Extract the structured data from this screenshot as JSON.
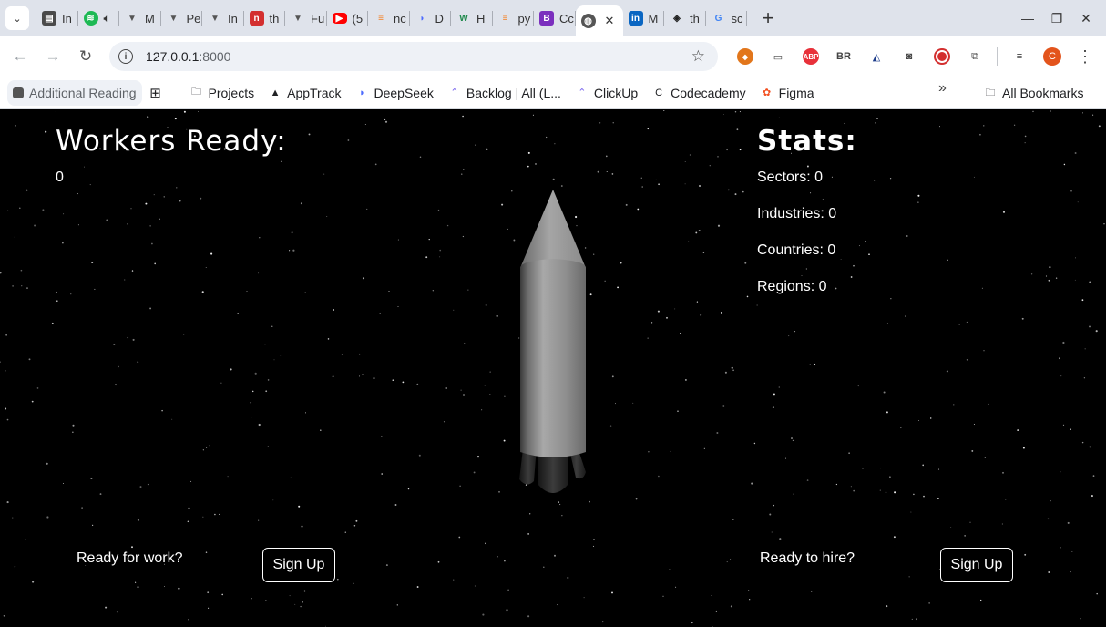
{
  "browser": {
    "tabs": [
      {
        "label": "In",
        "icon": "sheet-icon",
        "color": "#4a4a4a"
      },
      {
        "label": "",
        "icon": "spotify-icon",
        "color": "#1db954"
      },
      {
        "label": "M",
        "icon": "triangle-logo-icon",
        "color": "#555555"
      },
      {
        "label": "Pe",
        "icon": "triangle-logo-icon",
        "color": "#555555"
      },
      {
        "label": "In",
        "icon": "triangle-logo-icon",
        "color": "#555555"
      },
      {
        "label": "th",
        "icon": "n-logo-icon",
        "color": "#d32f2f"
      },
      {
        "label": "Fu",
        "icon": "triangle-logo-icon",
        "color": "#555555"
      },
      {
        "label": "(5",
        "icon": "youtube-icon",
        "color": "#ff0000"
      },
      {
        "label": "nc",
        "icon": "stack-icon",
        "color": "#f48024"
      },
      {
        "label": "D",
        "icon": "deepseek-icon",
        "color": "#4d6bfe"
      },
      {
        "label": "H",
        "icon": "w-logo-icon",
        "color": "#1f8a4c"
      },
      {
        "label": "py",
        "icon": "stack-icon",
        "color": "#f48024"
      },
      {
        "label": "Cc",
        "icon": "b-logo-icon",
        "color": "#7b2fbe"
      },
      {
        "label": "",
        "icon": "globe-icon",
        "color": "#555555",
        "active": true
      },
      {
        "label": "M",
        "icon": "linkedin-icon",
        "color": "#0a66c2"
      },
      {
        "label": "th",
        "icon": "codepen-icon",
        "color": "#222222"
      },
      {
        "label": "sc",
        "icon": "google-icon",
        "color": "#4285f4"
      }
    ],
    "url_host": "127.0.0.1",
    "url_port": ":8000",
    "bookmarks": [
      {
        "label": "Additional Reading",
        "icon": "square-icon"
      },
      {
        "label": "",
        "icon": "apps-grid-icon"
      },
      {
        "label": "Projects",
        "icon": "folder-icon"
      },
      {
        "label": "AppTrack",
        "icon": "apptrack-icon"
      },
      {
        "label": "DeepSeek",
        "icon": "deepseek-icon"
      },
      {
        "label": "Backlog | All (L...",
        "icon": "clickup-icon"
      },
      {
        "label": "ClickUp",
        "icon": "clickup-icon"
      },
      {
        "label": "Codecademy",
        "icon": "codecademy-icon"
      },
      {
        "label": "Figma",
        "icon": "figma-icon"
      }
    ],
    "more_bookmarks": "»",
    "all_bookmarks": "All Bookmarks",
    "profile_initial": "C"
  },
  "page": {
    "workers_title": "Workers Ready:",
    "workers_count": "0",
    "stats_title": "Stats:",
    "stats": [
      {
        "label": "Sectors: 0"
      },
      {
        "label": "Industries: 0"
      },
      {
        "label": "Countries: 0"
      },
      {
        "label": "Regions: 0"
      }
    ],
    "work_label": "Ready for work?",
    "work_button": "Sign Up",
    "hire_label": "Ready to hire?",
    "hire_button": "Sign Up"
  },
  "colors": {
    "background": "#000000",
    "text": "#ffffff",
    "rocket_body": "#9a9a9a"
  }
}
